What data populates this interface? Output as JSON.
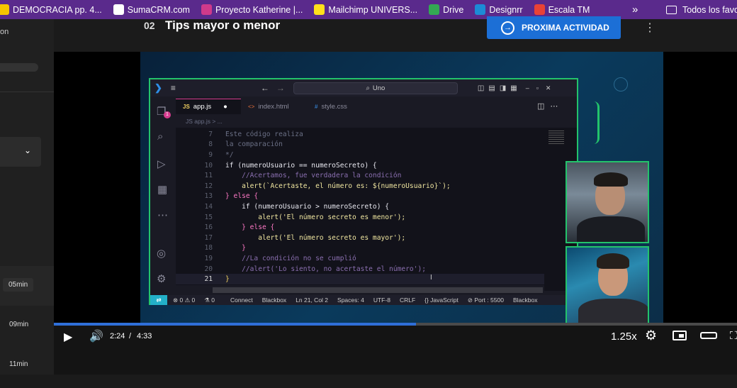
{
  "bookmarks": [
    {
      "label": "DEMOCRACIA pp. 4...",
      "icon": "democracia-icon",
      "color": "#f5c400"
    },
    {
      "label": "SumaCRM.com",
      "icon": "sumacrm-icon",
      "color": "#ffffff"
    },
    {
      "label": "Proyecto Katherine |...",
      "icon": "proyecto-icon",
      "color": "#d03a8b"
    },
    {
      "label": "Mailchimp UNIVERS...",
      "icon": "mailchimp-icon",
      "color": "#ffe01b"
    },
    {
      "label": "Drive",
      "icon": "drive-icon",
      "color": "#34a853"
    },
    {
      "label": "Designrr",
      "icon": "designrr-icon",
      "color": "#1c8bd6"
    },
    {
      "label": "Escala TM",
      "icon": "escala-icon",
      "color": "#e94235"
    }
  ],
  "bookmarks_more": "»",
  "bookmarks_folder": "Todos los favo",
  "sidebar": {
    "top_text": "on",
    "durations": [
      "05min",
      "09min",
      "11min"
    ]
  },
  "lesson": {
    "number": "02",
    "title": "Tips mayor o menor",
    "next_label": "PROXIMA ACTIVIDAD"
  },
  "vscode": {
    "search": "Uno",
    "tabs": [
      {
        "label": "app.js",
        "prefix": "JS",
        "active": true
      },
      {
        "label": "index.html",
        "prefix": "<>",
        "active": false
      },
      {
        "label": "style.css",
        "prefix": "#",
        "active": false
      }
    ],
    "breadcrumb": "JS app.js > ...",
    "code": [
      {
        "n": "7",
        "t": "Este código realiza",
        "c": "#6a6f85"
      },
      {
        "n": "8",
        "t": "la comparación",
        "c": "#6a6f85"
      },
      {
        "n": "9",
        "t": "*/",
        "c": "#6a6f85"
      },
      {
        "n": "10",
        "t": "if (numeroUsuario == numeroSecreto) {",
        "c": "#e8e8f0"
      },
      {
        "n": "11",
        "t": "    //Acertamos, fue verdadera la condición",
        "c": "#8a6fb0"
      },
      {
        "n": "12",
        "t": "    alert(`Acertaste, el número es: ${numeroUsuario}`);",
        "c": "#f0e6a0"
      },
      {
        "n": "13",
        "t": "} else {",
        "c": "#ff79c6"
      },
      {
        "n": "14",
        "t": "    if (numeroUsuario > numeroSecreto) {",
        "c": "#e8e8f0"
      },
      {
        "n": "15",
        "t": "        alert('El número secreto es menor');",
        "c": "#f0e6a0"
      },
      {
        "n": "16",
        "t": "    } else {",
        "c": "#ff79c6"
      },
      {
        "n": "17",
        "t": "        alert('El número secreto es mayor');",
        "c": "#f0e6a0"
      },
      {
        "n": "18",
        "t": "    }",
        "c": "#ff79c6"
      },
      {
        "n": "19",
        "t": "    //La condición no se cumplió",
        "c": "#8a6fb0"
      },
      {
        "n": "20",
        "t": "    //alert('Lo siento, no acertaste el número');",
        "c": "#8a6fb0"
      },
      {
        "n": "21",
        "t": "}",
        "c": "#f0d060"
      }
    ],
    "status": [
      "⊗ 0 ⚠ 0",
      "⚗ 0",
      "Connect",
      "Blackbox",
      "Ln 21, Col 2",
      "Spaces: 4",
      "UTF-8",
      "CRLF",
      "{} JavaScript",
      "⊘ Port : 5500",
      "Blackbox"
    ]
  },
  "player": {
    "time_current": "2:24",
    "time_separator": "/",
    "time_total": "4:33",
    "speed": "1.25x",
    "progress": 0.53
  }
}
